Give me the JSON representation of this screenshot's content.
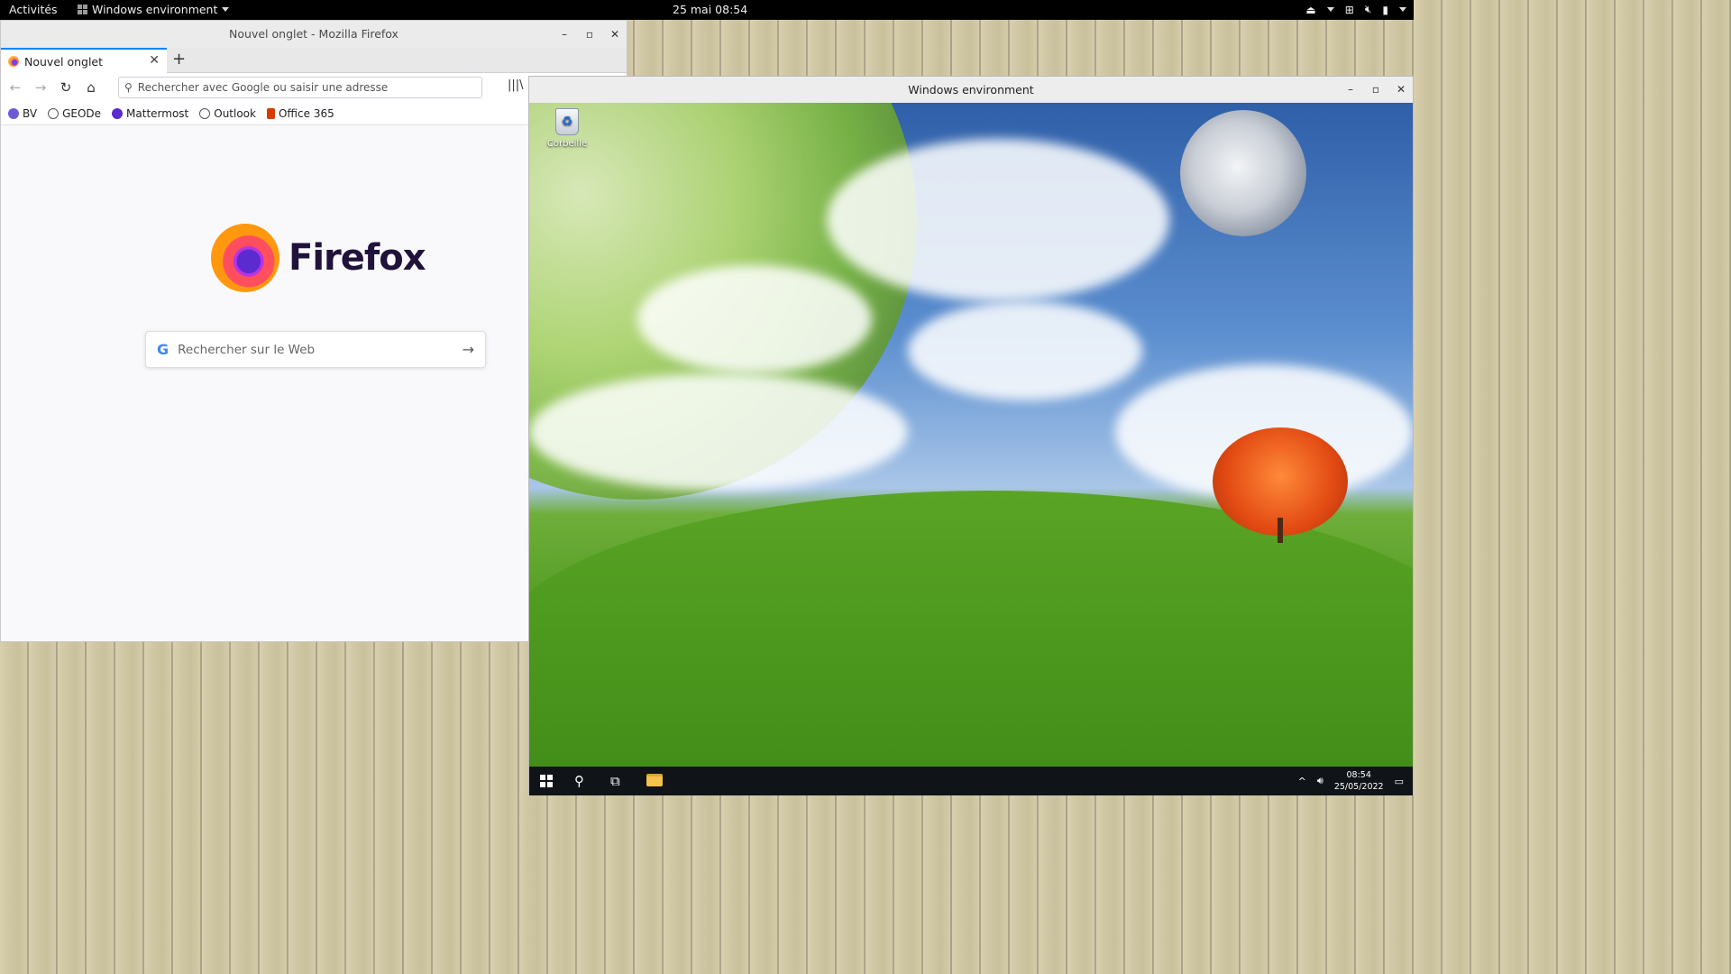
{
  "topbar": {
    "activities": "Activités",
    "app_menu": "Windows environment",
    "clock": "25 mai  08:54"
  },
  "firefox": {
    "window_title": "Nouvel onglet - Mozilla Firefox",
    "tab_label": "Nouvel onglet",
    "url_placeholder": "Rechercher avec Google ou saisir une adresse",
    "bookmarks": [
      {
        "label": "BV",
        "color": "#6d5cd6"
      },
      {
        "label": "GEODe",
        "color": "#555555"
      },
      {
        "label": "Mattermost",
        "color": "#5b2bd0"
      },
      {
        "label": "Outlook",
        "color": "#555555"
      },
      {
        "label": "Office 365",
        "color": "#d83b01"
      }
    ],
    "wordmark": "Firefox",
    "search_placeholder": "Rechercher sur le Web"
  },
  "windows_env": {
    "window_title": "Windows environment",
    "desktop_icon_label": "Corbeille",
    "taskbar_time": "08:54",
    "taskbar_date": "25/05/2022"
  },
  "colors": {
    "firefox_accent": "#0a84ff",
    "topbar_bg": "#000000",
    "taskbar_bg": "#101318"
  }
}
